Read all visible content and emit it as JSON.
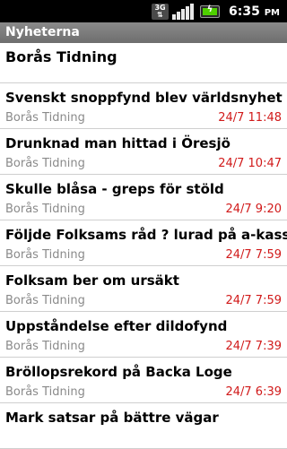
{
  "status_bar": {
    "network": "3G",
    "time": "6:35",
    "ampm": "PM"
  },
  "app": {
    "title": "Nyheterna"
  },
  "feed": {
    "name": "Borås Tidning",
    "items": [
      {
        "title": "Svenskt snoppfynd blev världsnyhet",
        "source": "Borås Tidning",
        "date": "24/7 11:48"
      },
      {
        "title": "Drunknad man hittad i Öresjö",
        "source": "Borås Tidning",
        "date": "24/7 10:47"
      },
      {
        "title": "Skulle blåsa - greps för stöld",
        "source": "Borås Tidning",
        "date": "24/7 9:20"
      },
      {
        "title": "Följde Folksams råd ? lurad på a-kassa",
        "source": "Borås Tidning",
        "date": "24/7 7:59"
      },
      {
        "title": "Folksam ber om ursäkt",
        "source": "Borås Tidning",
        "date": "24/7 7:59"
      },
      {
        "title": "Uppståndelse efter dildofynd",
        "source": "Borås Tidning",
        "date": "24/7 7:39"
      },
      {
        "title": "Bröllopsrekord på Backa Loge",
        "source": "Borås Tidning",
        "date": "24/7 6:39"
      },
      {
        "title": "Mark satsar på bättre vägar",
        "source": "",
        "date": ""
      }
    ]
  }
}
